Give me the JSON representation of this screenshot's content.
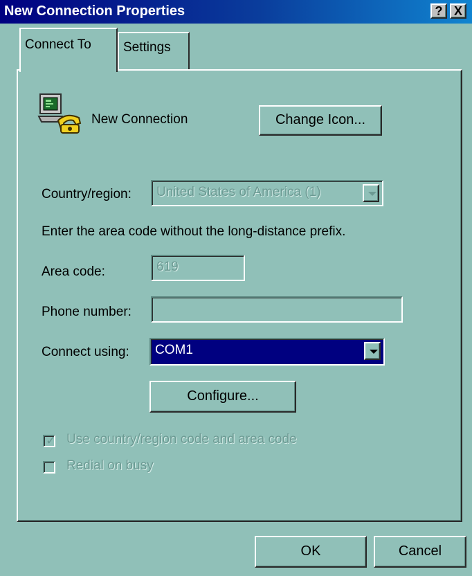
{
  "window": {
    "title": "New Connection Properties",
    "help_label": "?",
    "close_label": "X"
  },
  "tabs": [
    {
      "label": "Connect To",
      "active": true
    },
    {
      "label": "Settings",
      "active": false
    }
  ],
  "connection": {
    "icon": "phone-computer-icon",
    "name": "New Connection",
    "change_icon_label": "Change Icon..."
  },
  "form": {
    "country_label": "Country/region:",
    "country_value": "United States of America (1)",
    "instruction": "Enter the area code without the long-distance prefix.",
    "area_code_label": "Area code:",
    "area_code_value": "619",
    "phone_label": "Phone number:",
    "phone_value": "",
    "connect_using_label": "Connect using:",
    "connect_using_value": "COM1",
    "configure_label": "Configure..."
  },
  "options": {
    "use_country_code": {
      "label": "Use country/region code and area code",
      "checked": true,
      "enabled": false
    },
    "redial_on_busy": {
      "label": "Redial on busy",
      "checked": false,
      "enabled": false
    }
  },
  "footer": {
    "ok_label": "OK",
    "cancel_label": "Cancel"
  },
  "colors": {
    "face": "#90c0b8",
    "title_start": "#000080",
    "title_end": "#1084d0",
    "selection": "#000080",
    "disabled_text": "#6c9a93"
  }
}
